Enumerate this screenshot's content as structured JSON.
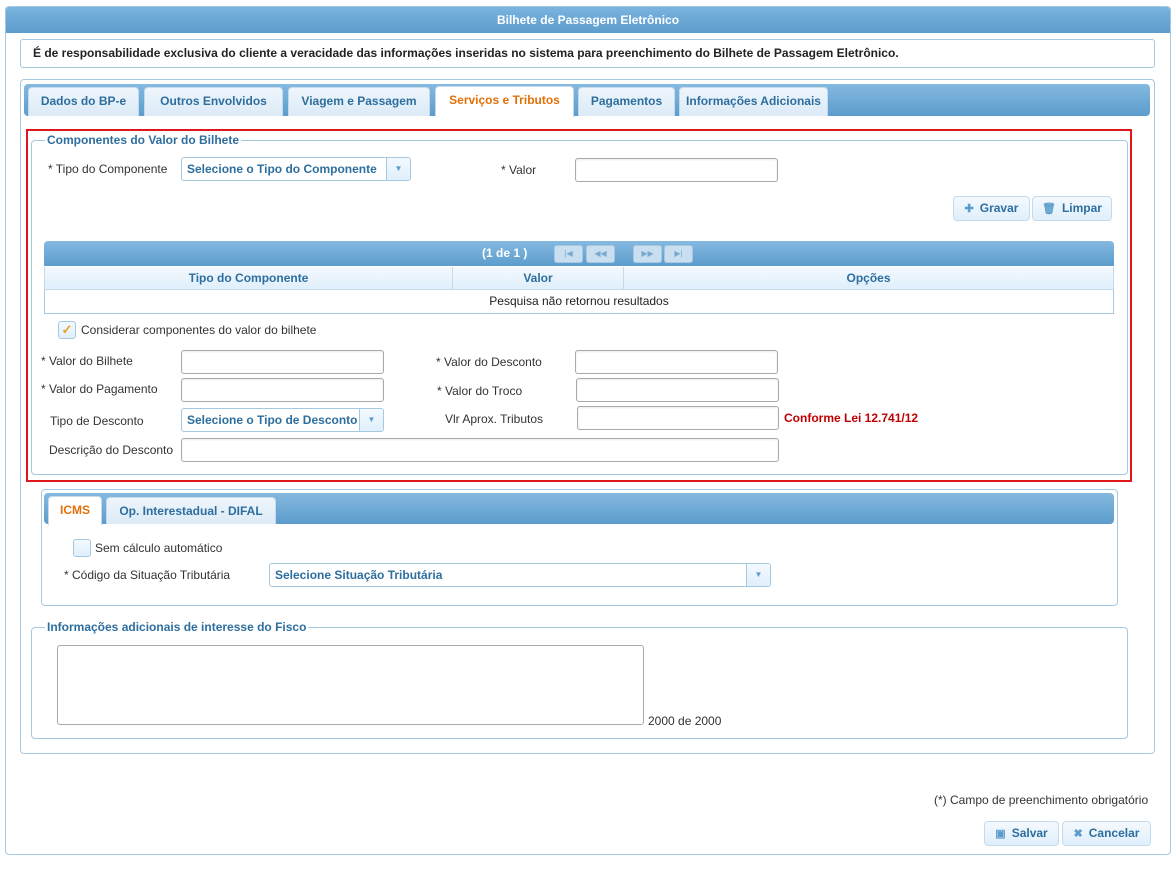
{
  "window": {
    "title": "Bilhete de Passagem Eletrônico"
  },
  "notice": "É de responsabilidade exclusiva do cliente a veracidade das informações inseridas no sistema para preenchimento do Bilhete de Passagem Eletrônico.",
  "tabs": [
    {
      "label": "Dados do BP-e"
    },
    {
      "label": "Outros Envolvidos"
    },
    {
      "label": "Viagem e Passagem"
    },
    {
      "label": "Serviços e Tributos"
    },
    {
      "label": "Pagamentos"
    },
    {
      "label": "Informações Adicionais"
    }
  ],
  "componentes": {
    "legend": "Componentes do Valor do Bilhete",
    "tipo_label": "* Tipo do Componente",
    "tipo_value": "Selecione o Tipo do Componente",
    "valor_label": "* Valor",
    "valor_value": "",
    "gravar_label": "Gravar",
    "limpar_label": "Limpar",
    "grid": {
      "pager": "(1 de 1 )",
      "columns": [
        "Tipo do Componente",
        "Valor",
        "Opções"
      ],
      "empty_message": "Pesquisa não retornou resultados"
    },
    "considerar_label": "Considerar componentes do valor do bilhete",
    "considerar_checked": true
  },
  "valores": {
    "valor_bilhete_label": "* Valor do Bilhete",
    "valor_desconto_label": "* Valor do Desconto",
    "valor_pagamento_label": "* Valor do Pagamento",
    "valor_troco_label": "* Valor do Troco",
    "tipo_desconto_label": "Tipo de Desconto",
    "tipo_desconto_value": "Selecione o Tipo de Desconto",
    "vlr_aprox_label": "Vlr Aprox. Tributos",
    "conforme_lei": "Conforme Lei 12.741/12",
    "descricao_desconto_label": "Descrição do Desconto"
  },
  "icms": {
    "tabs": [
      {
        "label": "ICMS"
      },
      {
        "label": "Op. Interestadual - DIFAL"
      }
    ],
    "sem_calculo_label": "Sem cálculo automático",
    "sem_calculo_checked": false,
    "cst_label": "* Código da Situação Tributária",
    "cst_value": "Selecione Situação Tributária"
  },
  "fisco": {
    "legend": "Informações adicionais de interesse do Fisco",
    "counter": "2000 de 2000"
  },
  "footer": {
    "required_note": "(*) Campo de preenchimento obrigatório",
    "salvar_label": "Salvar",
    "cancelar_label": "Cancelar"
  },
  "colors": {
    "accent_orange": "#e17009",
    "header_blue": "#5c9ccc",
    "highlight_red": "#e0161d"
  }
}
